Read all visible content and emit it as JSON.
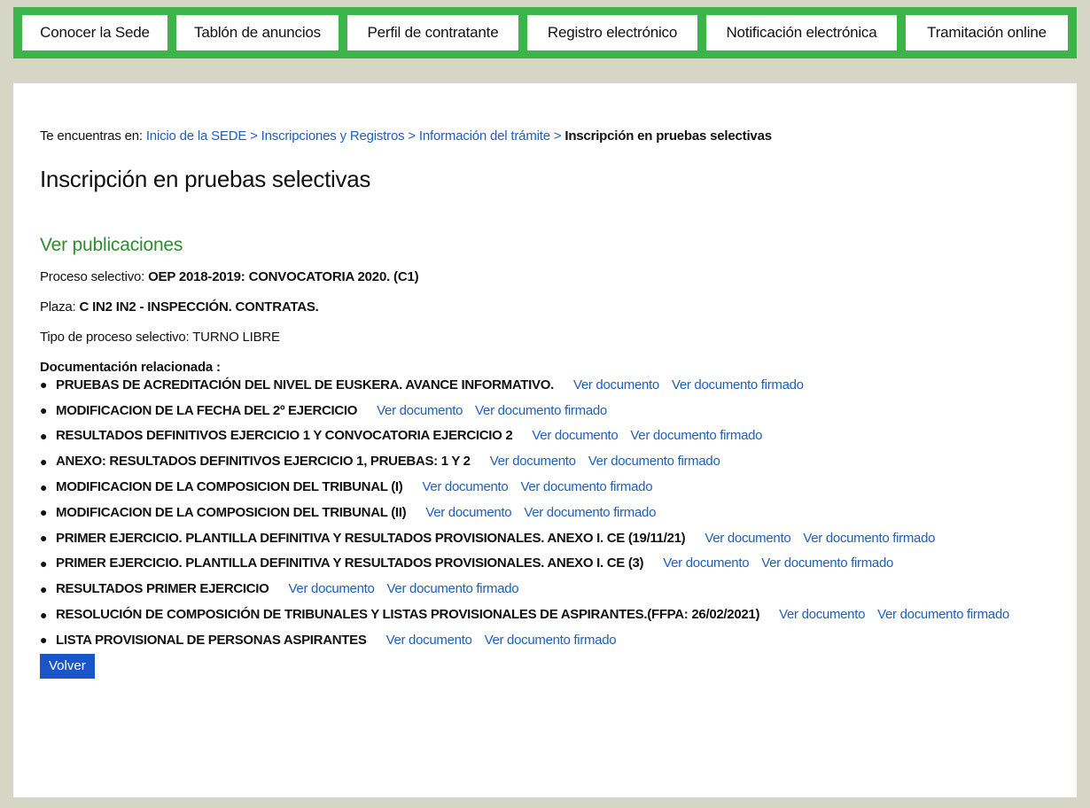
{
  "nav": {
    "items": [
      {
        "label": "Conocer la Sede"
      },
      {
        "label": "Tablón de anuncios"
      },
      {
        "label": "Perfil de contratante"
      },
      {
        "label": "Registro electrónico"
      },
      {
        "label": "Notificación electrónica"
      },
      {
        "label": "Tramitación online"
      }
    ]
  },
  "breadcrumb": {
    "prefix": "Te encuentras en:",
    "links": [
      "Inicio de la SEDE",
      "Inscripciones y Registros",
      "Información del trámite"
    ],
    "separator": ">",
    "current": "Inscripción en pruebas selectivas"
  },
  "page": {
    "title": "Inscripción en pruebas selectivas",
    "section_title": "Ver publicaciones",
    "process_label": "Proceso selectivo:",
    "process_value": "OEP 2018-2019: CONVOCATORIA 2020. (C1)",
    "plaza_label": "Plaza:",
    "plaza_value": "C IN2 IN2 - INSPECCIÓN. CONTRATAS.",
    "tipo_label": "Tipo de proceso selectivo:",
    "tipo_value": "TURNO LIBRE",
    "docs_title": "Documentación relacionada :",
    "doc_link_label": "Ver documento",
    "doc_signed_label": "Ver documento firmado",
    "back_label": "Volver"
  },
  "documents": [
    {
      "name": "PRUEBAS DE ACREDITACIÓN DEL NIVEL DE EUSKERA. AVANCE INFORMATIVO."
    },
    {
      "name": "MODIFICACION DE LA FECHA DEL 2º EJERCICIO"
    },
    {
      "name": "RESULTADOS DEFINITIVOS EJERCICIO 1 Y CONVOCATORIA EJERCICIO 2"
    },
    {
      "name": "ANEXO: RESULTADOS DEFINITIVOS EJERCICIO 1, PRUEBAS: 1 Y 2"
    },
    {
      "name": "MODIFICACION DE LA COMPOSICION DEL TRIBUNAL (I)"
    },
    {
      "name": "MODIFICACION DE LA COMPOSICION DEL TRIBUNAL (II)"
    },
    {
      "name": "PRIMER EJERCICIO. PLANTILLA DEFINITIVA Y RESULTADOS PROVISIONALES. ANEXO I. CE (19/11/21)"
    },
    {
      "name": "PRIMER EJERCICIO. PLANTILLA DEFINITIVA Y RESULTADOS PROVISIONALES. ANEXO I. CE (3)"
    },
    {
      "name": "RESULTADOS PRIMER EJERCICIO"
    },
    {
      "name": "RESOLUCIÓN DE COMPOSICIÓN DE TRIBUNALES Y LISTAS PROVISIONALES DE ASPIRANTES.(FFPA: 26/02/2021)"
    },
    {
      "name": "LISTA PROVISIONAL DE PERSONAS ASPIRANTES"
    }
  ],
  "colors": {
    "background": "#d5d6c6",
    "nav_bar": "#3bb54a",
    "link": "#1f5fb8",
    "section_title": "#2f8b2f",
    "button": "#1a56c8"
  }
}
